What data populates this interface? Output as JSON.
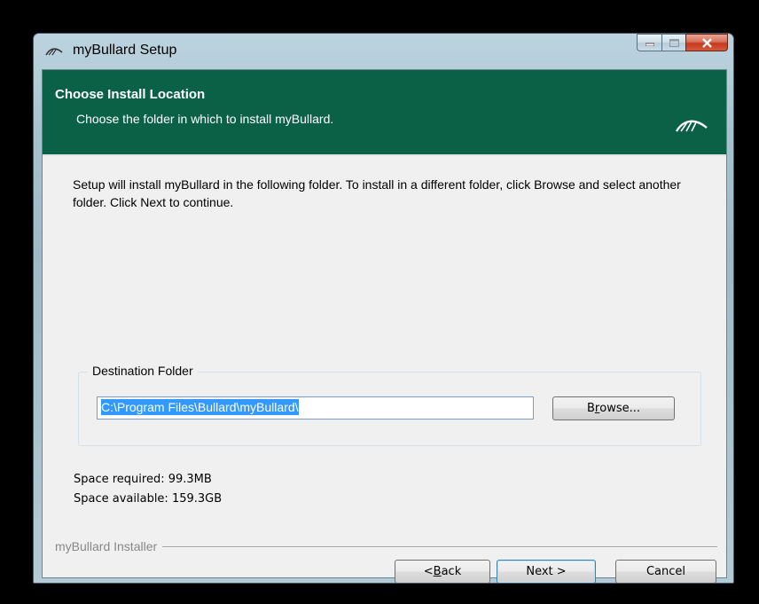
{
  "window": {
    "title": "myBullard Setup",
    "icon": "mybullard-logo-icon",
    "controls": {
      "minimize": "minimize-icon",
      "maximize": "maximize-icon",
      "close": "close-icon"
    }
  },
  "header": {
    "title": "Choose Install Location",
    "subtitle": "Choose the folder in which to install myBullard."
  },
  "body": {
    "intro": "Setup will install myBullard in the following folder. To install in a different folder, click Browse and select another folder. Click Next to continue.",
    "destination": {
      "group_label": "Destination Folder",
      "path_value": "C:\\Program Files\\Bullard\\myBullard\\",
      "browse_pre": "B",
      "browse_key": "r",
      "browse_post": "owse..."
    },
    "space_required": "Space required: 99.3MB",
    "space_available": "Space available: 159.3GB"
  },
  "footer": {
    "branding": "myBullard Installer",
    "back_pre": "< ",
    "back_key": "B",
    "back_post": "ack",
    "next_label": "Next >",
    "cancel_label": "Cancel"
  },
  "colors": {
    "header_bg": "#0b6146",
    "selection": "#3399ff",
    "close_button": "#c4391f"
  }
}
